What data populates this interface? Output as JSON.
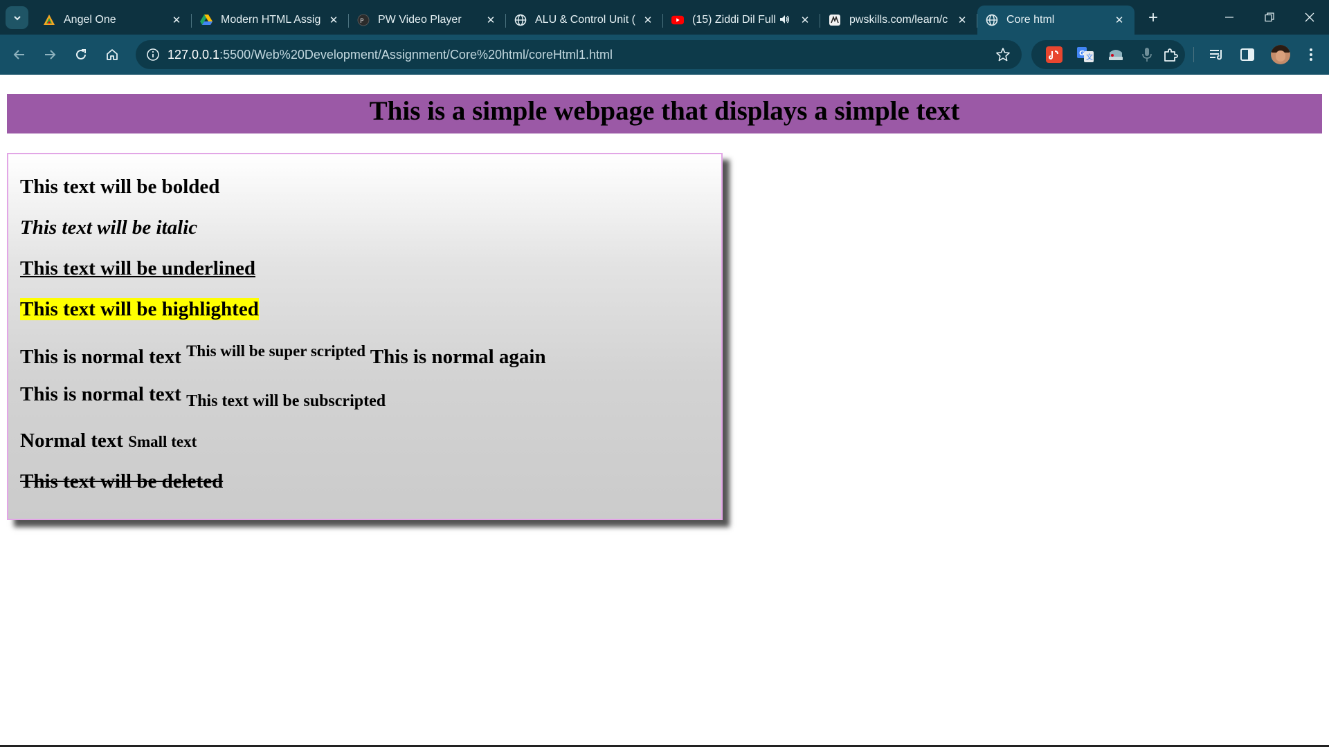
{
  "browser": {
    "tabs": [
      {
        "title": "Angel One",
        "icon": "angel-one-logo-icon",
        "active": false
      },
      {
        "title": "Modern HTML Assign",
        "icon": "google-drive-icon",
        "active": false
      },
      {
        "title": "PW Video Player",
        "icon": "pw-logo-icon",
        "active": false
      },
      {
        "title": "ALU & Control Unit (",
        "icon": "globe-icon",
        "active": false
      },
      {
        "title": "(15) Ziddi Dil Full",
        "icon": "youtube-icon",
        "active": false,
        "audio": true
      },
      {
        "title": "pwskills.com/learn/c",
        "icon": "pwskills-icon",
        "active": false
      },
      {
        "title": "Core html",
        "icon": "globe-icon",
        "active": true
      }
    ],
    "url_host": "127.0.0.1",
    "url_rest": ":5500/Web%20Development/Assignment/Core%20html/coreHtml1.html"
  },
  "page": {
    "heading": "This is a simple webpage that displays a simple text",
    "bold_text": "This text will be bolded",
    "italic_text": "This text will be italic",
    "underlined_text": "This text will be underlined",
    "highlighted_text": "This text will be highlighted",
    "sup_line": {
      "before": "This is normal text ",
      "sup": "This will be super scripted",
      "after": " This is normal again"
    },
    "sub_line": {
      "before": "This is normal text ",
      "sub": "This text will be subscripted"
    },
    "small_line": {
      "normal": "Normal text ",
      "small": "Small text"
    },
    "deleted_text": "This text will be deleted"
  },
  "colors": {
    "chrome_dark": "#0d3240",
    "chrome_toolbar": "#155067",
    "heading_bg": "#9b59a6",
    "highlight": "#ffff00",
    "card_border": "#e2a6e6"
  }
}
